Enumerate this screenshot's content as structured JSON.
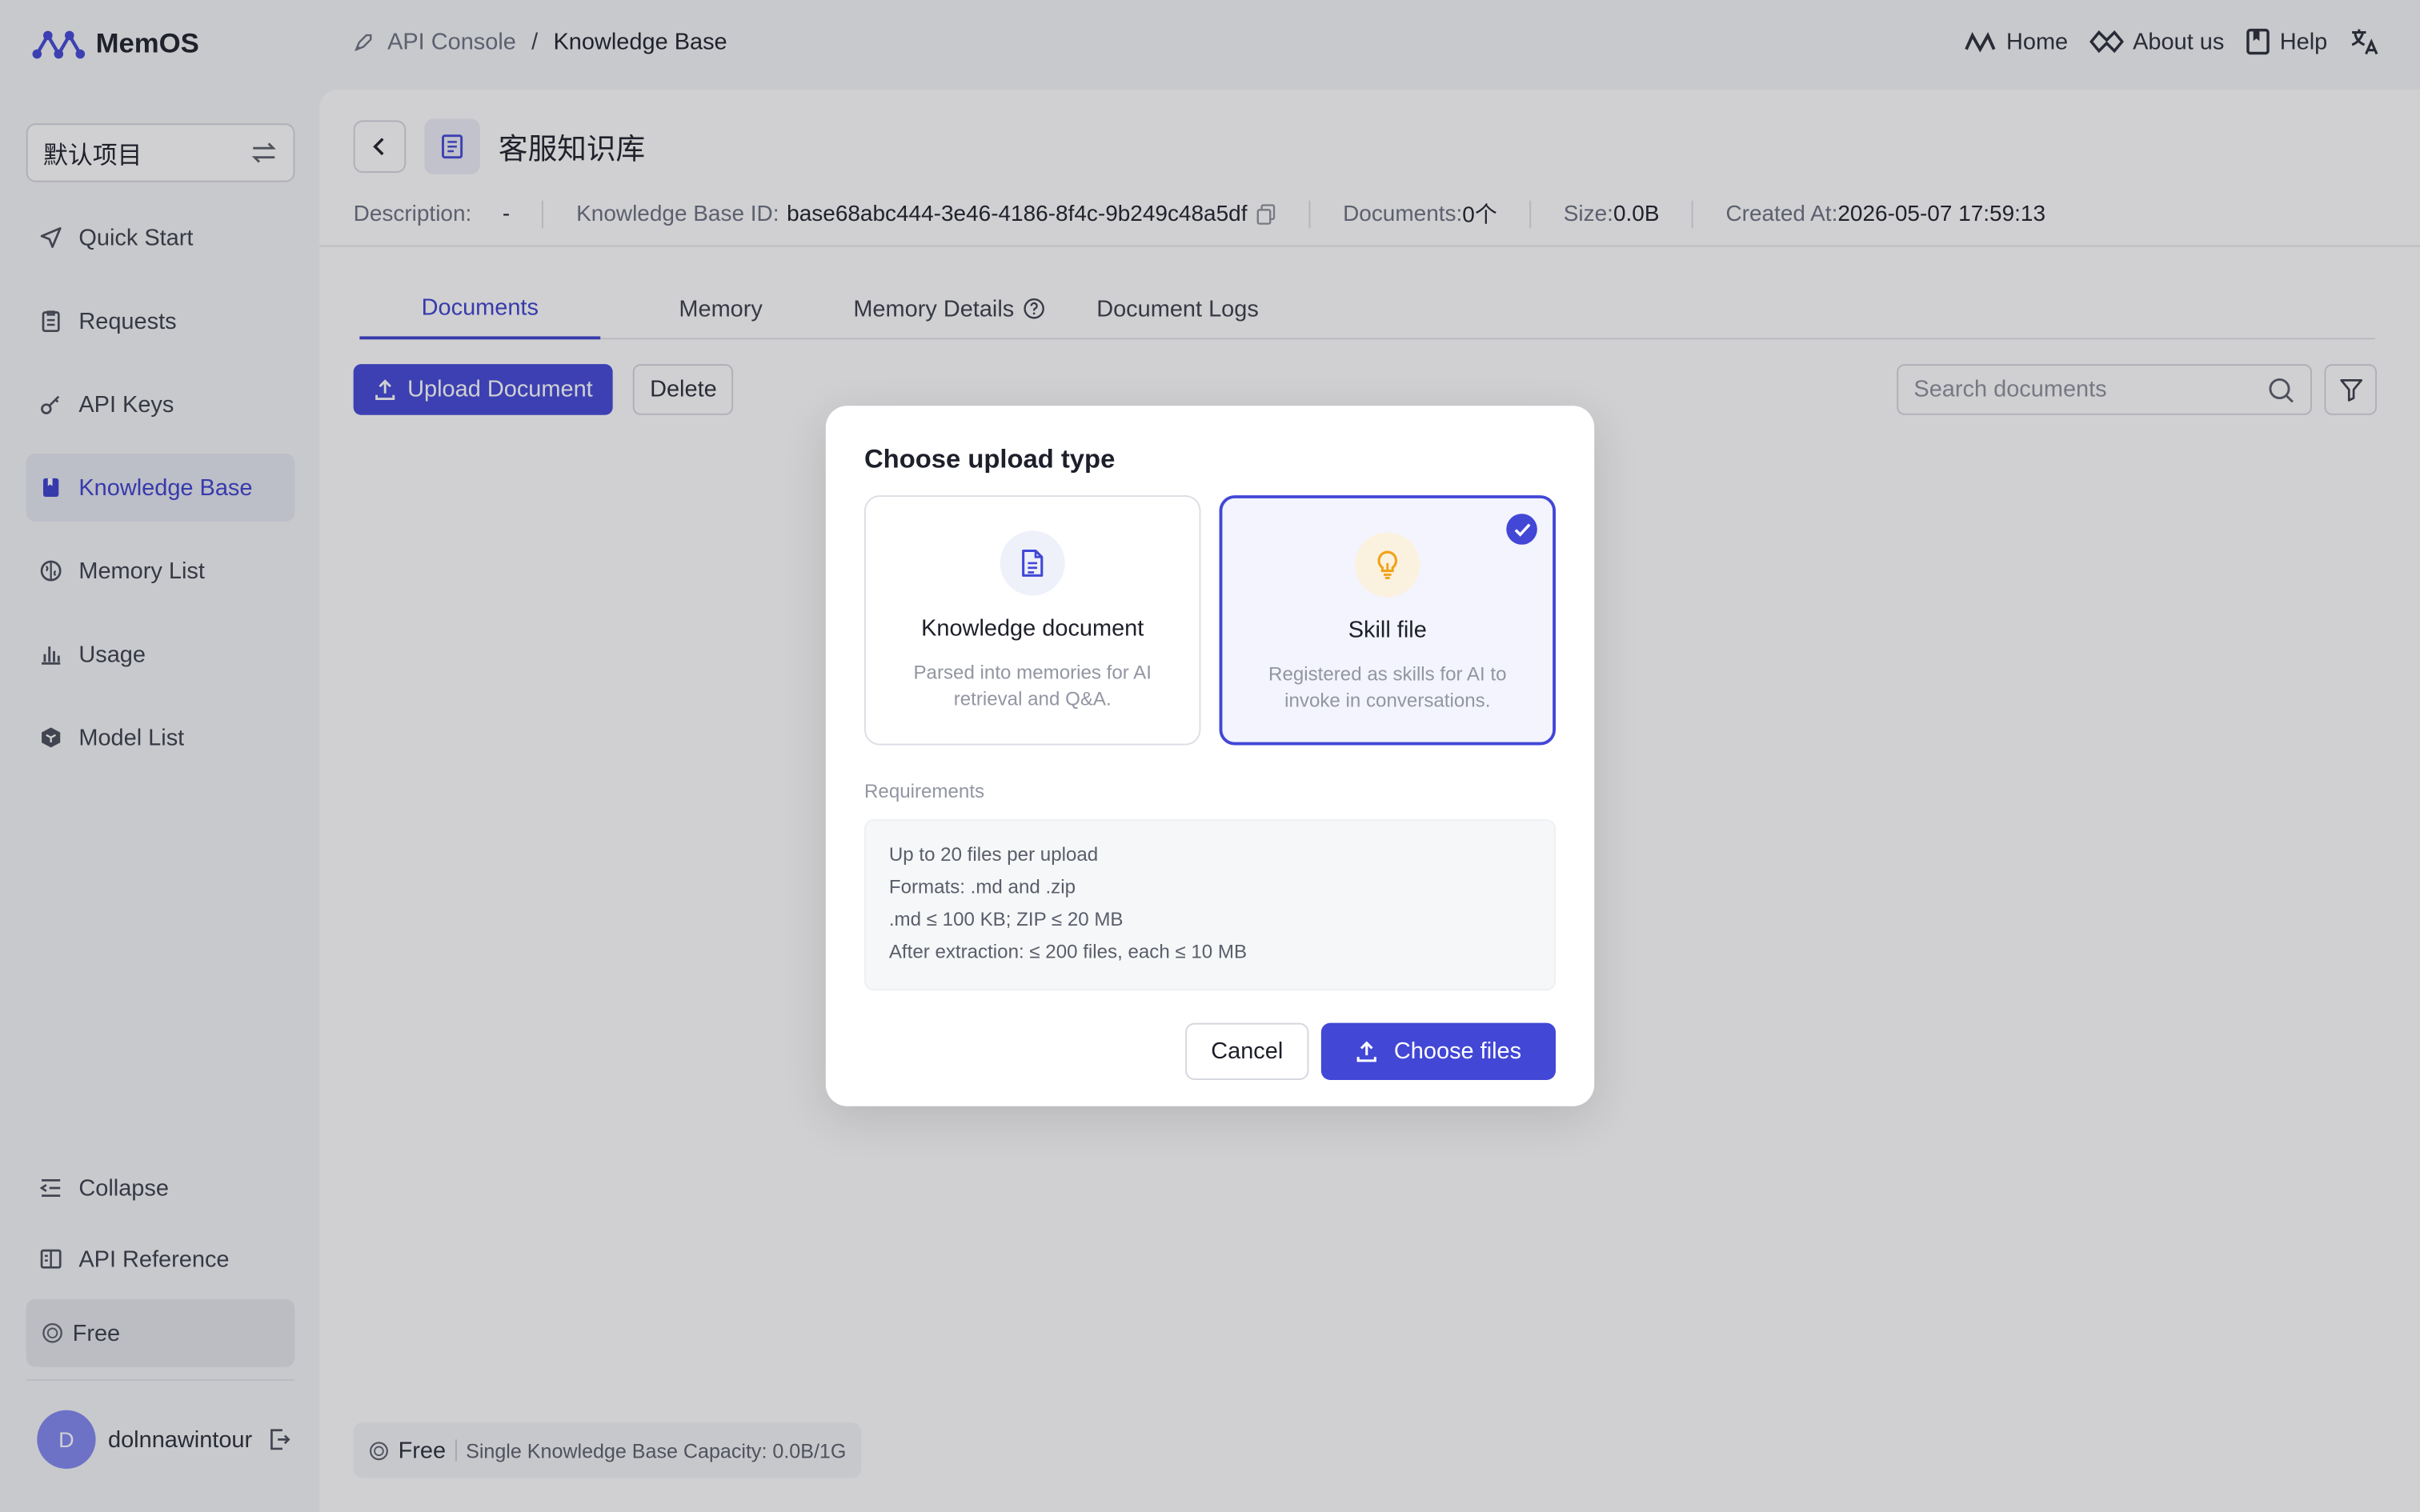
{
  "app": {
    "name": "MemOS"
  },
  "breadcrumb": {
    "root": "API Console",
    "separator": "/",
    "current": "Knowledge Base"
  },
  "top_nav": {
    "home": "Home",
    "about": "About us",
    "help": "Help"
  },
  "sidebar": {
    "project": "默认项目",
    "items": [
      {
        "label": "Quick Start",
        "icon": "send-icon"
      },
      {
        "label": "Requests",
        "icon": "clipboard-icon"
      },
      {
        "label": "API Keys",
        "icon": "key-icon"
      },
      {
        "label": "Knowledge Base",
        "icon": "bookmark-icon",
        "active": true
      },
      {
        "label": "Memory List",
        "icon": "brain-icon"
      },
      {
        "label": "Usage",
        "icon": "bar-chart-icon"
      },
      {
        "label": "Model List",
        "icon": "cube-icon"
      }
    ],
    "collapse": "Collapse",
    "api_reference": "API Reference",
    "plan": "Free",
    "user": {
      "initial": "D",
      "name": "dolnnawintour"
    }
  },
  "kb": {
    "title": "客服知识库",
    "description_label": "Description:",
    "description_value": "-",
    "id_label": "Knowledge Base ID:",
    "id_value": "base68abc444-3e46-4186-8f4c-9b249c48a5df",
    "documents_label": "Documents:",
    "documents_value": "0个",
    "size_label": "Size:",
    "size_value": "0.0B",
    "created_label": "Created At:",
    "created_value": "2026-05-07 17:59:13"
  },
  "tabs": [
    "Documents",
    "Memory",
    "Memory Details",
    "Document Logs"
  ],
  "toolbar": {
    "upload": "Upload Document",
    "delete": "Delete",
    "search_placeholder": "Search documents"
  },
  "footer": {
    "plan": "Free",
    "capacity": "Single Knowledge Base Capacity: 0.0B/1G"
  },
  "modal": {
    "title": "Choose upload type",
    "options": [
      {
        "name": "Knowledge document",
        "desc": "Parsed into memories for AI retrieval and Q&A.",
        "icon": "document-icon",
        "selected": false
      },
      {
        "name": "Skill file",
        "desc": "Registered as skills for AI to invoke in conversations.",
        "icon": "lightbulb-icon",
        "selected": true
      }
    ],
    "requirements_label": "Requirements",
    "requirements": [
      "Up to 20 files per upload",
      "Formats: .md and .zip",
      ".md ≤ 100 KB; ZIP ≤ 20 MB",
      "After extraction: ≤ 200 files, each ≤ 10 MB"
    ],
    "cancel": "Cancel",
    "choose": "Choose files"
  },
  "colors": {
    "accent": "#4247d6",
    "skill_icon": "#f0a318"
  }
}
